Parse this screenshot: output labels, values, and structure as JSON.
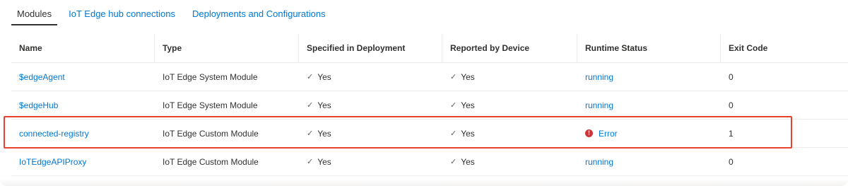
{
  "tabs": [
    {
      "label": "Modules",
      "active": true
    },
    {
      "label": "IoT Edge hub connections",
      "active": false
    },
    {
      "label": "Deployments and Configurations",
      "active": false
    }
  ],
  "table": {
    "headers": [
      "Name",
      "Type",
      "Specified in Deployment",
      "Reported by Device",
      "Runtime Status",
      "Exit Code"
    ],
    "rows": [
      {
        "name": "$edgeAgent",
        "type": "IoT Edge System Module",
        "specified": "Yes",
        "reported": "Yes",
        "status": "running",
        "exit_code": "0"
      },
      {
        "name": "$edgeHub",
        "type": "IoT Edge System Module",
        "specified": "Yes",
        "reported": "Yes",
        "status": "running",
        "exit_code": "0"
      },
      {
        "name": "connected-registry",
        "type": "IoT Edge Custom Module",
        "specified": "Yes",
        "reported": "Yes",
        "status": "Error",
        "exit_code": "1"
      },
      {
        "name": "IoTEdgeAPIProxy",
        "type": "IoT Edge Custom Module",
        "specified": "Yes",
        "reported": "Yes",
        "status": "running",
        "exit_code": "0"
      }
    ]
  },
  "icons": {
    "check": "checkmark-icon",
    "error": "error-icon"
  },
  "colors": {
    "link": "#0078d4",
    "error": "#d13438",
    "highlight": "#e8412c"
  }
}
